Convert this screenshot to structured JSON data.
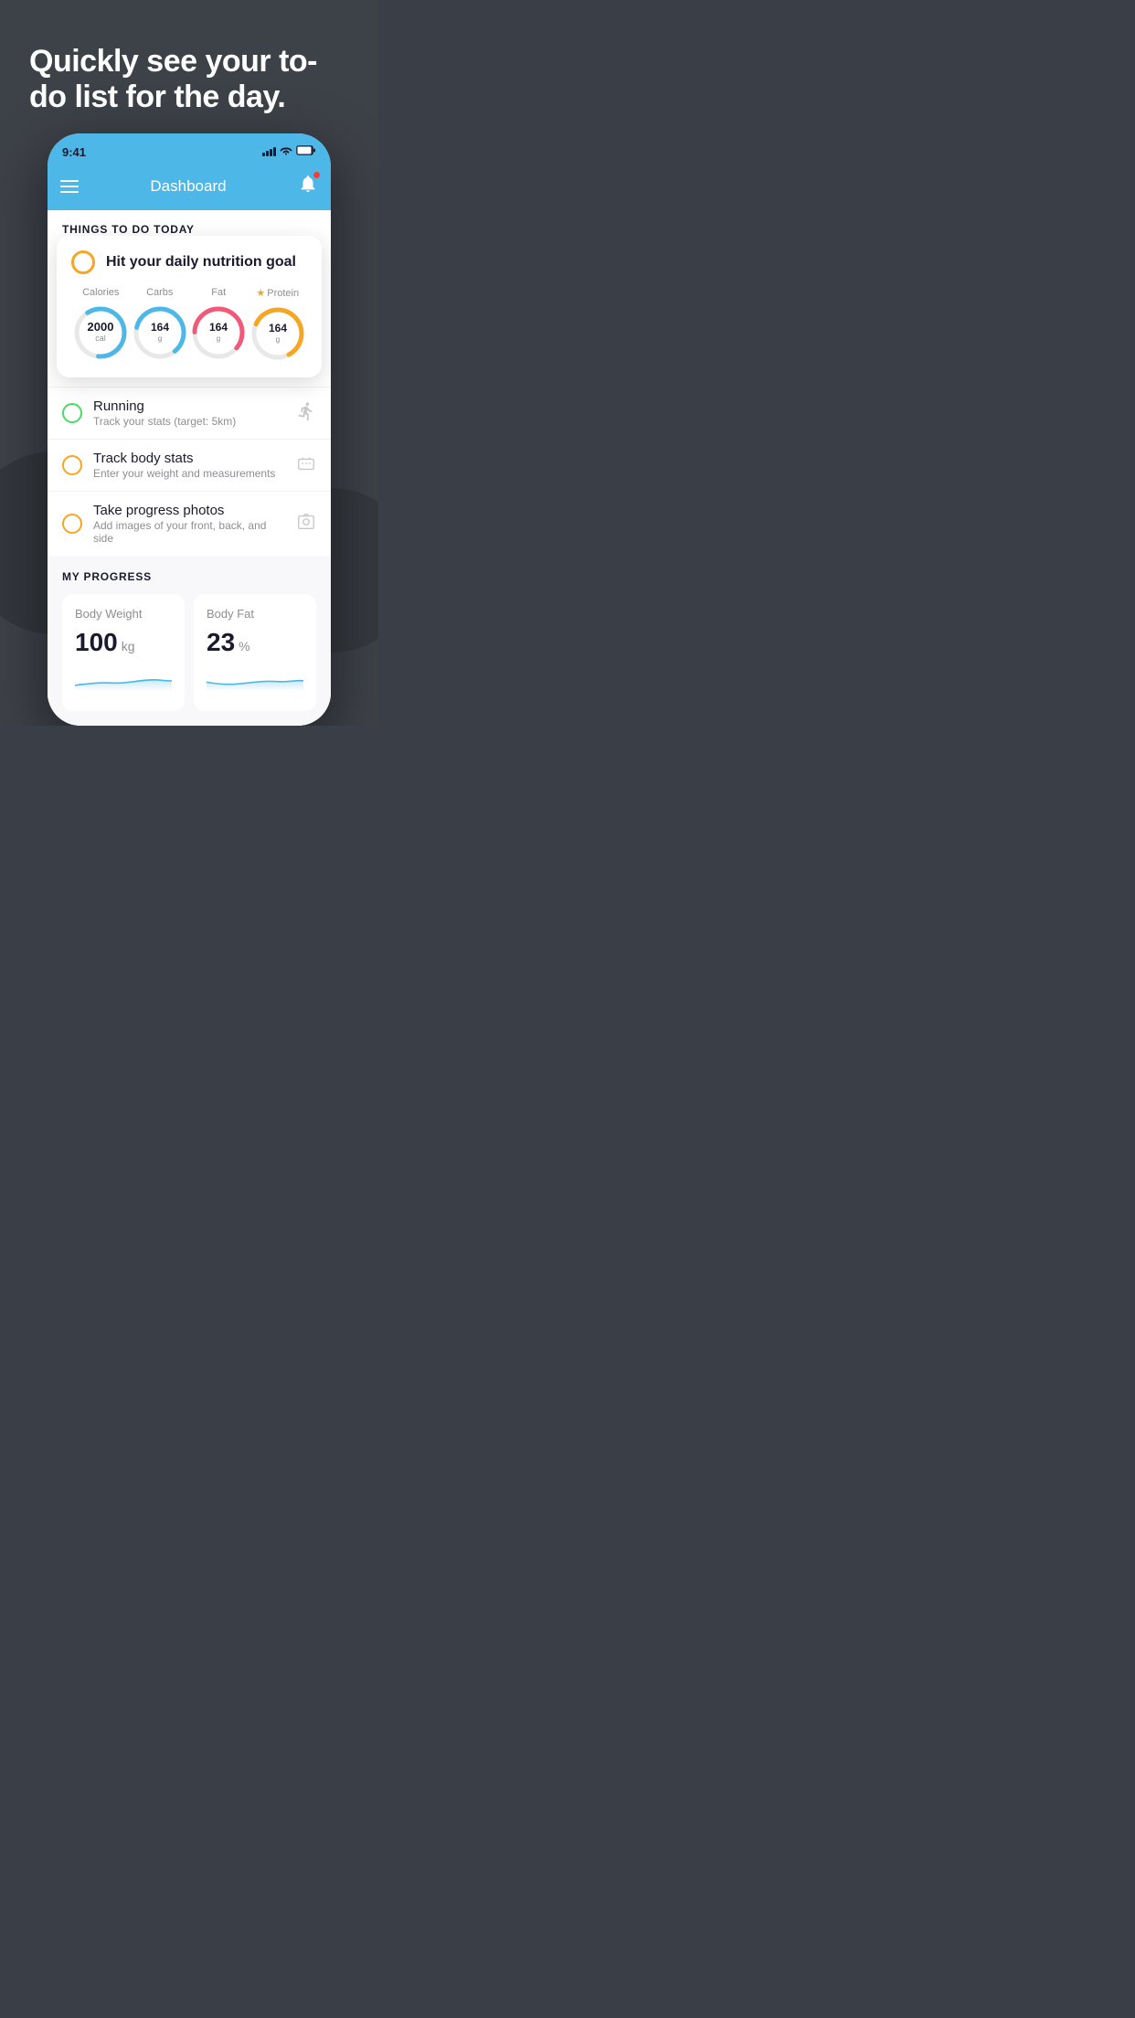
{
  "page": {
    "background_color": "#3d4148"
  },
  "hero": {
    "title": "Quickly see your to-do list for the day."
  },
  "phone": {
    "status_bar": {
      "time": "9:41",
      "signal_label": "signal",
      "wifi_label": "wifi",
      "battery_label": "battery"
    },
    "header": {
      "menu_label": "menu",
      "title": "Dashboard",
      "notification_label": "notifications"
    },
    "things_section": {
      "label": "THINGS TO DO TODAY"
    },
    "nutrition_card": {
      "title": "Hit your daily nutrition goal",
      "metrics": [
        {
          "label": "Calories",
          "value": "2000",
          "unit": "cal",
          "color": "#4db8e8",
          "starred": false
        },
        {
          "label": "Carbs",
          "value": "164",
          "unit": "g",
          "color": "#4db8e8",
          "starred": false
        },
        {
          "label": "Fat",
          "value": "164",
          "unit": "g",
          "color": "#f05a78",
          "starred": false
        },
        {
          "label": "Protein",
          "value": "164",
          "unit": "g",
          "color": "#f5a623",
          "starred": true
        }
      ]
    },
    "todo_items": [
      {
        "title": "Running",
        "subtitle": "Track your stats (target: 5km)",
        "circle_color": "green",
        "icon": "shoe"
      },
      {
        "title": "Track body stats",
        "subtitle": "Enter your weight and measurements",
        "circle_color": "yellow",
        "icon": "scale"
      },
      {
        "title": "Take progress photos",
        "subtitle": "Add images of your front, back, and side",
        "circle_color": "yellow",
        "icon": "photo"
      }
    ],
    "progress_section": {
      "label": "MY PROGRESS",
      "cards": [
        {
          "title": "Body Weight",
          "value": "100",
          "unit": "kg"
        },
        {
          "title": "Body Fat",
          "value": "23",
          "unit": "%"
        }
      ]
    }
  }
}
